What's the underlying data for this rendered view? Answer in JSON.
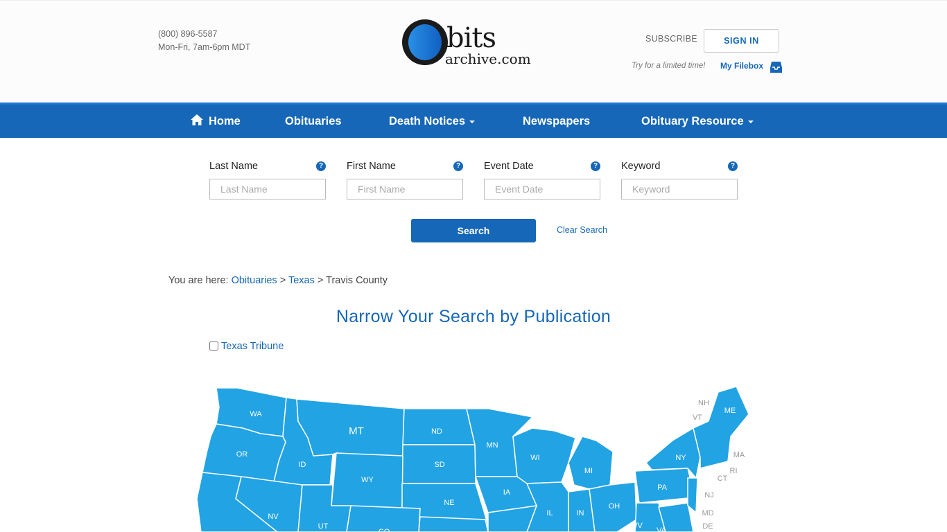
{
  "header": {
    "phone": "(800) 896-5587",
    "hours": "Mon-Fri, 7am-6pm MDT",
    "logo_main": "bits",
    "logo_sub": "archive.com",
    "subscribe": "SUBSCRIBE",
    "sign_in": "SIGN IN",
    "try_text": "Try for a limited time!",
    "filebox": "My Filebox"
  },
  "nav": {
    "items": [
      {
        "label": "Home",
        "icon": "home-icon"
      },
      {
        "label": "Obituaries"
      },
      {
        "label": "Death Notices",
        "dropdown": true
      },
      {
        "label": "Newspapers"
      },
      {
        "label": "Obituary Resource",
        "dropdown": true
      }
    ]
  },
  "search": {
    "fields": [
      {
        "label": "Last Name",
        "placeholder": "Last Name",
        "value": ""
      },
      {
        "label": "First Name",
        "placeholder": "First Name",
        "value": ""
      },
      {
        "label": "Event Date",
        "placeholder": "Event Date",
        "value": ""
      },
      {
        "label": "Keyword",
        "placeholder": "Keyword",
        "value": ""
      }
    ],
    "help": "?",
    "search_button": "Search",
    "clear_link": "Clear Search"
  },
  "breadcrumb": {
    "prefix": "You are here:",
    "items": [
      "Obituaries",
      "Texas",
      "Travis County"
    ],
    "separator": ">"
  },
  "publication": {
    "title": "Narrow Your Search by Publication",
    "options": [
      {
        "label": "Texas Tribune",
        "checked": false
      }
    ]
  },
  "map": {
    "fill_color": "#22a3e3",
    "states": [
      "WA",
      "MT",
      "ND",
      "MN",
      "ME",
      "OR",
      "ID",
      "SD",
      "WI",
      "NY",
      "MI",
      "WY",
      "IA",
      "PA",
      "NE",
      "NV",
      "UT",
      "IL",
      "IN",
      "OH",
      "WV",
      "VA",
      "CO"
    ],
    "outside_labels": [
      "NH",
      "VT",
      "MA",
      "RI",
      "CT",
      "NJ",
      "MD",
      "DE"
    ]
  },
  "colors": {
    "brand_blue": "#1667b8",
    "map_blue": "#22a3e3"
  }
}
